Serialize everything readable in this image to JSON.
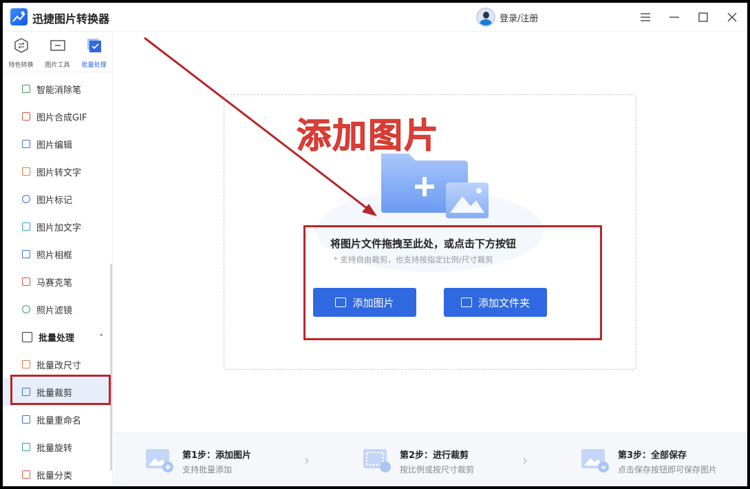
{
  "app": {
    "title": "迅捷图片转换器",
    "login": "登录/注册"
  },
  "topnav": [
    {
      "label": "特色转换",
      "icon": "swap-icon"
    },
    {
      "label": "图片工具",
      "icon": "image-tool-icon"
    },
    {
      "label": "批量处理",
      "icon": "batch-icon"
    }
  ],
  "menu": {
    "items": [
      {
        "label": "智能消除笔"
      },
      {
        "label": "图片合成GIF"
      },
      {
        "label": "图片编辑"
      },
      {
        "label": "图片转文字"
      },
      {
        "label": "图片标记"
      },
      {
        "label": "图片加文字"
      },
      {
        "label": "照片相框"
      },
      {
        "label": "马赛克笔"
      },
      {
        "label": "照片滤镜"
      }
    ],
    "group_label": "批量处理",
    "group_items": [
      {
        "label": "批量改尺寸"
      },
      {
        "label": "批量裁剪"
      },
      {
        "label": "批量重命名"
      },
      {
        "label": "批量旋转"
      },
      {
        "label": "批量分类"
      }
    ]
  },
  "main": {
    "annotation": "添加图片",
    "drag_text": "将图片文件拖拽至此处，或点击下方按钮",
    "hint_text": "* 支持自由裁剪，也支持按指定比例/尺寸裁剪",
    "add_image_button": "添加图片",
    "add_folder_button": "添加文件夹"
  },
  "steps": [
    {
      "title": "第1步：添加图片",
      "desc": "支持批量添加"
    },
    {
      "title": "第2步：进行裁剪",
      "desc": "按比例或按尺寸裁剪"
    },
    {
      "title": "第3步：全部保存",
      "desc": "点击保存按钮即可保存图片"
    }
  ],
  "colors": {
    "accent": "#2f68e0",
    "annotation_red": "#b8252a",
    "heading_red": "#e8453c"
  }
}
